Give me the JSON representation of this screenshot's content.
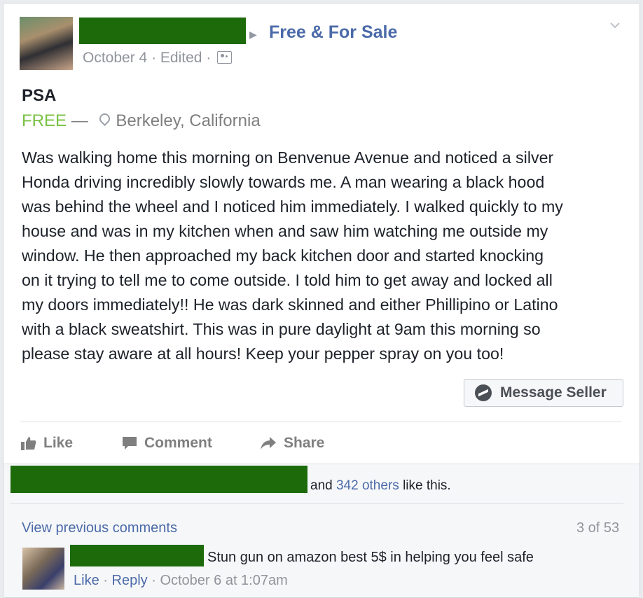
{
  "post": {
    "group_name": "Free & For Sale",
    "date": "October 4",
    "separator": "·",
    "edited": "Edited",
    "title": "PSA",
    "price": "FREE",
    "dash": "—",
    "location": "Berkeley, California",
    "body": "Was walking home this morning on Benvenue Avenue and noticed a silver\nHonda driving incredibly slowly towards me. A man wearing a black hood\nwas behind the wheel and I noticed him immediately. I walked quickly to my\nhouse and was in my kitchen when and saw him watching me outside my\nwindow. He then approached my back kitchen door and started knocking\non it trying to tell me to come outside. I told him to get away and locked all\nmy doors immediately!! He was dark skinned and either Phillipino or Latino\nwith a black sweatshirt. This was in pure daylight at 9am this morning so\nplease stay aware at all hours! Keep your pepper spray on you too!",
    "message_button": "Message Seller"
  },
  "actions": {
    "like": "Like",
    "comment": "Comment",
    "share": "Share"
  },
  "likes": {
    "prefix": "and",
    "others_link": "342 others",
    "suffix": "like this."
  },
  "comments": {
    "view_previous": "View previous comments",
    "count": "3 of 53",
    "items": [
      {
        "text": "Stun gun on amazon best 5$ in helping you feel safe",
        "like": "Like",
        "reply": "Reply",
        "time": "October 6 at 1:07am"
      }
    ]
  },
  "colors": {
    "link": "#4b6aa9",
    "price": "#7ac143",
    "redaction": "#1d6a0a"
  }
}
